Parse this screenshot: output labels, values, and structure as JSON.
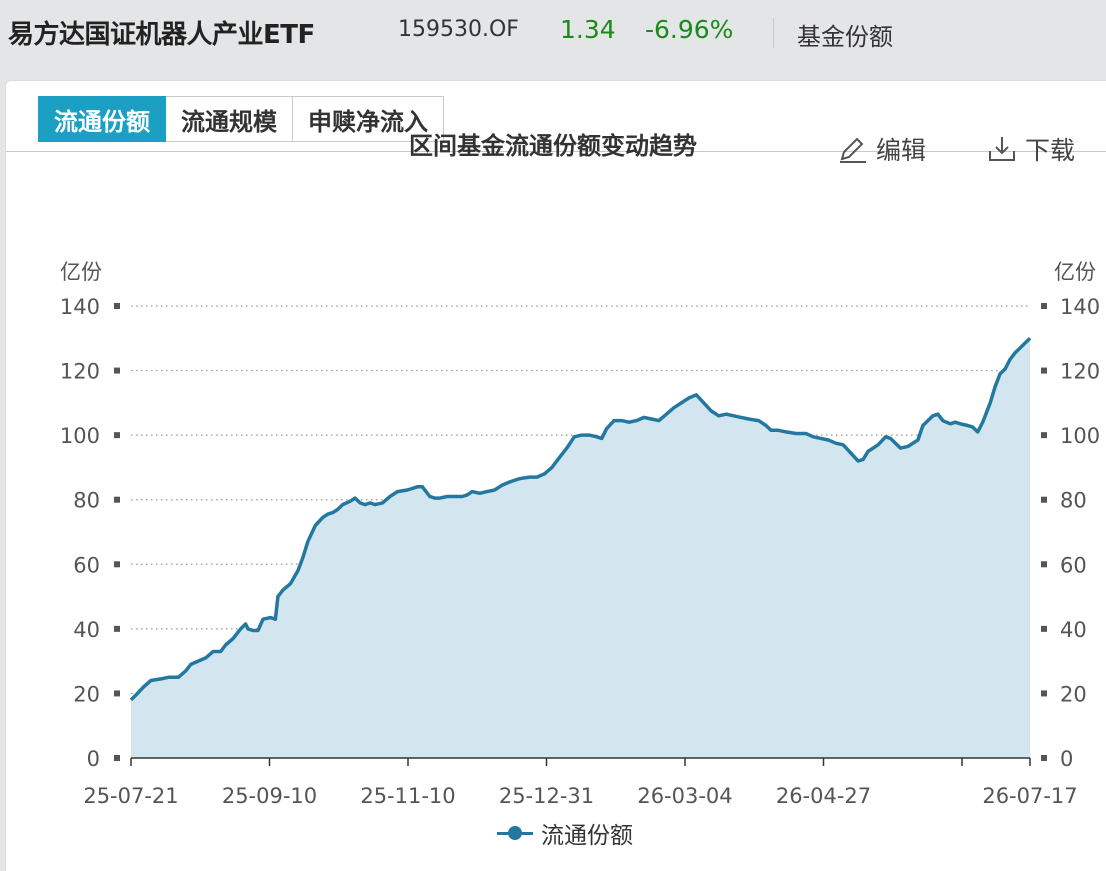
{
  "header": {
    "fund_name": "易方达国证机器人产业ETF",
    "fund_code": "159530.OF",
    "price": "1.34",
    "change_pct": "-6.96%",
    "section_link": "基金份额",
    "change_color": "#1a8a1a"
  },
  "tabs": [
    {
      "label": "流通份额",
      "active": true
    },
    {
      "label": "流通规模",
      "active": false
    },
    {
      "label": "申赎净流入",
      "active": false
    }
  ],
  "toolbar": {
    "edit_label": "编辑",
    "download_label": "下载"
  },
  "colors": {
    "accent": "#1b9fc3",
    "line": "#2378a1",
    "area": "#d3e5ee"
  },
  "chart_data": {
    "type": "area",
    "title": "区间基金流通份额变动趋势",
    "y_unit_left": "亿份",
    "y_unit_right": "亿份",
    "ylim": [
      0,
      140
    ],
    "yticks": [
      0,
      20,
      40,
      60,
      80,
      100,
      120,
      140
    ],
    "xlim": [
      "2025-07-21",
      "2026-07-17"
    ],
    "xtick_labels": [
      "25-07-21",
      "25-09-10",
      "25-11-10",
      "25-12-31",
      "26-03-04",
      "26-04-27",
      "26-07-17"
    ],
    "grid": true,
    "legend_position": "bottom",
    "series": [
      {
        "name": "流通份额",
        "points": [
          [
            "2025-07-21",
            18
          ],
          [
            "2025-07-23",
            19.5
          ],
          [
            "2025-07-26",
            22
          ],
          [
            "2025-07-29",
            24
          ],
          [
            "2025-08-02",
            24.5
          ],
          [
            "2025-08-05",
            25
          ],
          [
            "2025-08-09",
            25
          ],
          [
            "2025-08-12",
            27
          ],
          [
            "2025-08-14",
            29
          ],
          [
            "2025-08-17",
            30
          ],
          [
            "2025-08-20",
            31
          ],
          [
            "2025-08-23",
            33
          ],
          [
            "2025-08-26",
            33
          ],
          [
            "2025-08-28",
            35
          ],
          [
            "2025-08-31",
            37
          ],
          [
            "2025-09-03",
            40
          ],
          [
            "2025-09-05",
            41.5
          ],
          [
            "2025-09-06",
            40
          ],
          [
            "2025-09-08",
            39.5
          ],
          [
            "2025-09-10",
            39.5
          ],
          [
            "2025-09-12",
            43
          ],
          [
            "2025-09-15",
            43.5
          ],
          [
            "2025-09-17",
            43
          ],
          [
            "2025-09-18",
            50
          ],
          [
            "2025-09-20",
            52
          ],
          [
            "2025-09-23",
            54
          ],
          [
            "2025-09-26",
            58
          ],
          [
            "2025-09-28",
            62
          ],
          [
            "2025-09-30",
            67
          ],
          [
            "2025-10-03",
            72
          ],
          [
            "2025-10-06",
            74.5
          ],
          [
            "2025-10-08",
            75.5
          ],
          [
            "2025-10-10",
            76
          ],
          [
            "2025-10-12",
            77
          ],
          [
            "2025-10-14",
            78.5
          ],
          [
            "2025-10-17",
            79.5
          ],
          [
            "2025-10-19",
            80.5
          ],
          [
            "2025-10-21",
            79
          ],
          [
            "2025-10-23",
            78.5
          ],
          [
            "2025-10-25",
            79
          ],
          [
            "2025-10-27",
            78.5
          ],
          [
            "2025-10-30",
            79
          ],
          [
            "2025-11-02",
            81
          ],
          [
            "2025-11-05",
            82.5
          ],
          [
            "2025-11-09",
            83
          ],
          [
            "2025-11-13",
            84
          ],
          [
            "2025-11-15",
            84
          ],
          [
            "2025-11-18",
            81
          ],
          [
            "2025-11-20",
            80.5
          ],
          [
            "2025-11-22",
            80.5
          ],
          [
            "2025-11-25",
            81
          ],
          [
            "2025-11-28",
            81
          ],
          [
            "2025-12-01",
            81
          ],
          [
            "2025-12-03",
            81.5
          ],
          [
            "2025-12-05",
            82.5
          ],
          [
            "2025-12-08",
            82
          ],
          [
            "2025-12-11",
            82.5
          ],
          [
            "2025-12-14",
            83
          ],
          [
            "2025-12-17",
            84.5
          ],
          [
            "2025-12-20",
            85.5
          ],
          [
            "2025-12-24",
            86.5
          ],
          [
            "2025-12-28",
            87
          ],
          [
            "2025-12-31",
            87
          ],
          [
            "2026-01-03",
            88
          ],
          [
            "2026-01-06",
            90
          ],
          [
            "2026-01-09",
            93
          ],
          [
            "2026-01-12",
            96
          ],
          [
            "2026-01-15",
            99.5
          ],
          [
            "2026-01-18",
            100
          ],
          [
            "2026-01-21",
            100
          ],
          [
            "2026-01-24",
            99.5
          ],
          [
            "2026-01-26",
            99
          ],
          [
            "2026-01-28",
            102
          ],
          [
            "2026-01-31",
            104.5
          ],
          [
            "2026-02-03",
            104.5
          ],
          [
            "2026-02-06",
            104
          ],
          [
            "2026-02-09",
            104.5
          ],
          [
            "2026-02-12",
            105.5
          ],
          [
            "2026-02-15",
            105
          ],
          [
            "2026-02-18",
            104.5
          ],
          [
            "2026-02-21",
            106.5
          ],
          [
            "2026-02-24",
            108.5
          ],
          [
            "2026-02-27",
            110
          ],
          [
            "2026-03-02",
            111.5
          ],
          [
            "2026-03-05",
            112.5
          ],
          [
            "2026-03-08",
            110
          ],
          [
            "2026-03-11",
            107.5
          ],
          [
            "2026-03-14",
            106
          ],
          [
            "2026-03-17",
            106.5
          ],
          [
            "2026-03-20",
            106
          ],
          [
            "2026-03-23",
            105.5
          ],
          [
            "2026-03-26",
            105
          ],
          [
            "2026-03-30",
            104.5
          ],
          [
            "2026-04-02",
            103
          ],
          [
            "2026-04-04",
            101.5
          ],
          [
            "2026-04-07",
            101.5
          ],
          [
            "2026-04-10",
            101
          ],
          [
            "2026-04-14",
            100.5
          ],
          [
            "2026-04-18",
            100.5
          ],
          [
            "2026-04-21",
            99.5
          ],
          [
            "2026-04-24",
            99
          ],
          [
            "2026-04-27",
            98.5
          ],
          [
            "2026-04-30",
            97.5
          ],
          [
            "2026-05-03",
            97
          ],
          [
            "2026-05-06",
            94.5
          ],
          [
            "2026-05-09",
            92
          ],
          [
            "2026-05-11",
            92.5
          ],
          [
            "2026-05-13",
            95
          ],
          [
            "2026-05-15",
            96
          ],
          [
            "2026-05-17",
            97
          ],
          [
            "2026-05-20",
            99.5
          ],
          [
            "2026-05-22",
            99
          ],
          [
            "2026-05-24",
            97.5
          ],
          [
            "2026-05-26",
            96
          ],
          [
            "2026-05-29",
            96.5
          ],
          [
            "2026-05-31",
            97.5
          ],
          [
            "2026-06-02",
            98.5
          ],
          [
            "2026-06-04",
            103
          ],
          [
            "2026-06-06",
            104.5
          ],
          [
            "2026-06-08",
            106
          ],
          [
            "2026-06-10",
            106.5
          ],
          [
            "2026-06-12",
            104.5
          ],
          [
            "2026-06-15",
            103.5
          ],
          [
            "2026-06-17",
            104
          ],
          [
            "2026-06-19",
            103.5
          ],
          [
            "2026-06-22",
            103
          ],
          [
            "2026-06-24",
            102.5
          ],
          [
            "2026-06-26",
            101
          ],
          [
            "2026-06-28",
            104
          ],
          [
            "2026-07-01",
            110
          ],
          [
            "2026-07-03",
            115
          ],
          [
            "2026-07-05",
            119
          ],
          [
            "2026-07-07",
            120.5
          ],
          [
            "2026-07-09",
            123.5
          ],
          [
            "2026-07-11",
            125.5
          ],
          [
            "2026-07-13",
            127
          ],
          [
            "2026-07-15",
            128.5
          ],
          [
            "2026-07-17",
            130
          ]
        ]
      }
    ]
  }
}
